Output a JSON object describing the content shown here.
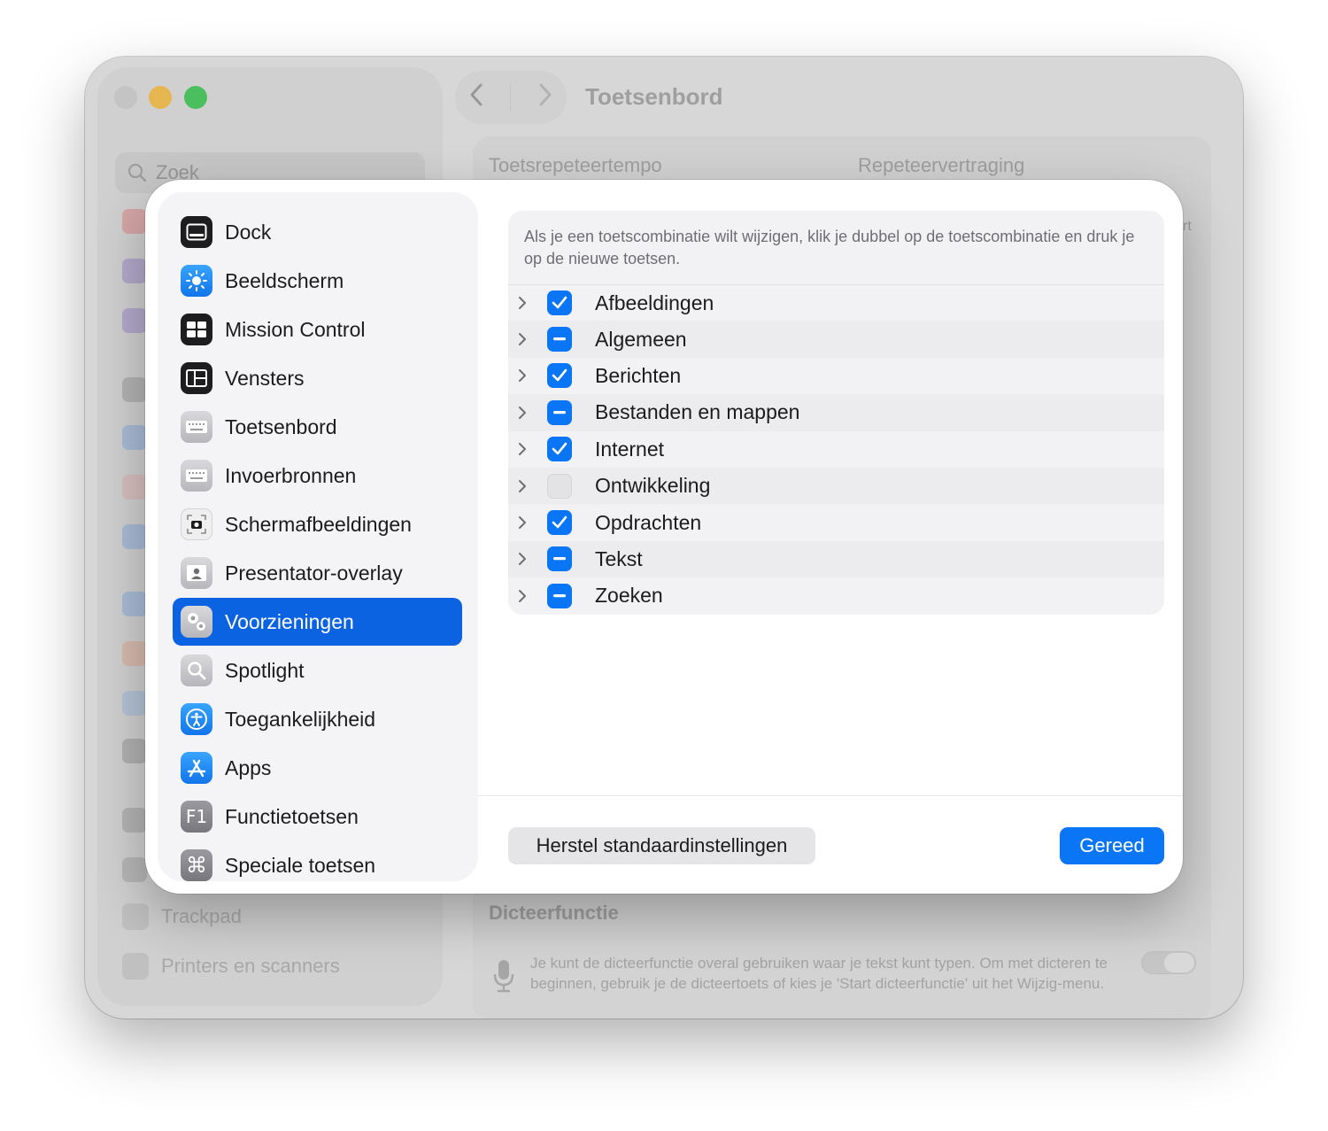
{
  "background": {
    "title": "Toetsenbord",
    "search_placeholder": "Zoek",
    "repeat_rate_label": "Toetsrepeteertempo",
    "repeat_delay_label": "Repeteervertraging",
    "partial_label": "rt",
    "sidebar_bottom": [
      {
        "label": "Trackpad",
        "icon": "trackpad-icon"
      },
      {
        "label": "Printers en scanners",
        "icon": "printer-icon"
      }
    ],
    "dictation_heading": "Dicteerfunctie",
    "dictation_text": "Je kunt de dicteerfunctie overal gebruiken waar je tekst kunt typen. Om met dicteren te beginnen, gebruik je de dicteertoets of kies je 'Start dicteerfunctie' uit het Wijzig-menu."
  },
  "sheet": {
    "sidebar": [
      {
        "label": "Dock",
        "icon": "dock-icon"
      },
      {
        "label": "Beeldscherm",
        "icon": "display-icon"
      },
      {
        "label": "Mission Control",
        "icon": "mission-control-icon"
      },
      {
        "label": "Vensters",
        "icon": "windows-icon"
      },
      {
        "label": "Toetsenbord",
        "icon": "keyboard-icon"
      },
      {
        "label": "Invoerbronnen",
        "icon": "input-sources-icon"
      },
      {
        "label": "Schermafbeeldingen",
        "icon": "screenshot-icon"
      },
      {
        "label": "Presentator-overlay",
        "icon": "presenter-overlay-icon"
      },
      {
        "label": "Voorzieningen",
        "icon": "services-gear-icon",
        "selected": true
      },
      {
        "label": "Spotlight",
        "icon": "spotlight-icon"
      },
      {
        "label": "Toegankelijkheid",
        "icon": "accessibility-icon"
      },
      {
        "label": "Apps",
        "icon": "app-store-icon"
      },
      {
        "label": "Functietoetsen",
        "icon": "function-keys-icon"
      },
      {
        "label": "Speciale toetsen",
        "icon": "command-key-icon"
      }
    ],
    "info": "Als je een toetscombinatie wilt wijzigen, klik je dubbel op de toetscombinatie en druk je op de nieuwe toetsen.",
    "categories": [
      {
        "label": "Afbeeldingen",
        "state": "checked"
      },
      {
        "label": "Algemeen",
        "state": "mixed"
      },
      {
        "label": "Berichten",
        "state": "checked"
      },
      {
        "label": "Bestanden en mappen",
        "state": "mixed"
      },
      {
        "label": "Internet",
        "state": "checked"
      },
      {
        "label": "Ontwikkeling",
        "state": "unchecked"
      },
      {
        "label": "Opdrachten",
        "state": "checked"
      },
      {
        "label": "Tekst",
        "state": "mixed"
      },
      {
        "label": "Zoeken",
        "state": "mixed"
      }
    ],
    "reset_button": "Herstel standaardinstellingen",
    "done_button": "Gereed"
  },
  "colors": {
    "accent": "#0b76f5",
    "selection": "#0b63e1"
  }
}
